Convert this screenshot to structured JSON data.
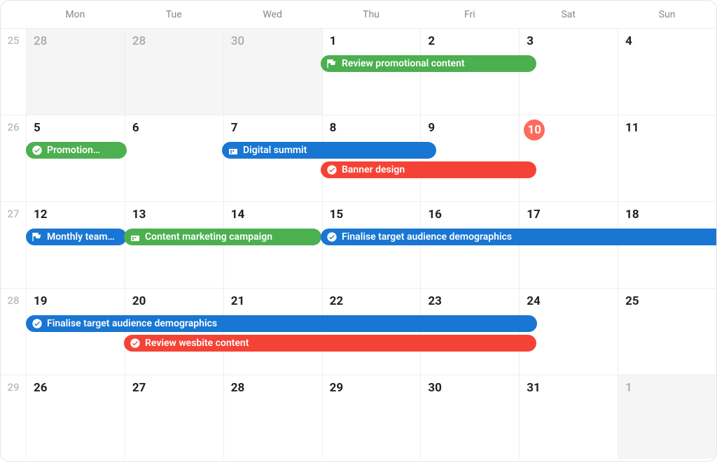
{
  "calendar": {
    "dayHeaders": [
      "Mon",
      "Tue",
      "Wed",
      "Thu",
      "Fri",
      "Sat",
      "Sun"
    ],
    "weeks": [
      {
        "num": "25",
        "days": [
          {
            "label": "28",
            "out": true
          },
          {
            "label": "28",
            "out": true
          },
          {
            "label": "30",
            "out": true
          },
          {
            "label": "1"
          },
          {
            "label": "2"
          },
          {
            "label": "3"
          },
          {
            "label": "4"
          }
        ]
      },
      {
        "num": "26",
        "days": [
          {
            "label": "5"
          },
          {
            "label": "6"
          },
          {
            "label": "7"
          },
          {
            "label": "8"
          },
          {
            "label": "9"
          },
          {
            "label": "10",
            "today": true
          },
          {
            "label": "11"
          }
        ]
      },
      {
        "num": "27",
        "days": [
          {
            "label": "12"
          },
          {
            "label": "13"
          },
          {
            "label": "14"
          },
          {
            "label": "15"
          },
          {
            "label": "16"
          },
          {
            "label": "17"
          },
          {
            "label": "18"
          }
        ]
      },
      {
        "num": "28",
        "days": [
          {
            "label": "19"
          },
          {
            "label": "20"
          },
          {
            "label": "21"
          },
          {
            "label": "22"
          },
          {
            "label": "23"
          },
          {
            "label": "24"
          },
          {
            "label": "25"
          }
        ]
      },
      {
        "num": "29",
        "days": [
          {
            "label": "26"
          },
          {
            "label": "27"
          },
          {
            "label": "28"
          },
          {
            "label": "29"
          },
          {
            "label": "30"
          },
          {
            "label": "31"
          },
          {
            "label": "1",
            "out": true
          }
        ]
      }
    ],
    "events": {
      "review_promotional": {
        "label": "Review promotional content",
        "icon": "flag",
        "color": "green"
      },
      "promotion": {
        "label": "Promotion…",
        "icon": "check",
        "color": "green"
      },
      "digital_summit": {
        "label": "Digital summit",
        "icon": "calendar",
        "color": "blue"
      },
      "banner_design": {
        "label": "Banner design",
        "icon": "check",
        "color": "red"
      },
      "monthly_team": {
        "label": "Monthly team…",
        "icon": "flag",
        "color": "blue"
      },
      "content_marketing": {
        "label": "Content marketing campaign",
        "icon": "calendar",
        "color": "green"
      },
      "finalise_target_1": {
        "label": "Finalise target audience demographics",
        "icon": "check",
        "color": "blue"
      },
      "finalise_target_2": {
        "label": "Finalise target audience demographics",
        "icon": "check",
        "color": "blue"
      },
      "review_website": {
        "label": "Review wesbite content",
        "icon": "check",
        "color": "red"
      }
    },
    "colors": {
      "green": "#4caf50",
      "blue": "#1976d2",
      "red": "#f44336",
      "today": "#ff6a5c"
    }
  }
}
